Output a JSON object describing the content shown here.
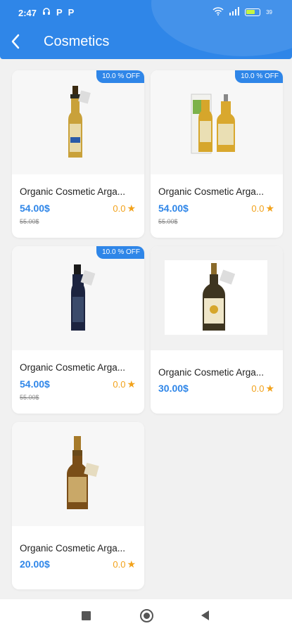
{
  "status_bar": {
    "time": "2:47",
    "left_icons": [
      "headphones-icon",
      "P",
      "P"
    ],
    "right_icons": [
      "wifi-icon",
      "signal-icon",
      "battery-icon"
    ],
    "battery_label": "39"
  },
  "header": {
    "title": "Cosmetics",
    "back_icon": "back-arrow-icon",
    "color": "#2f86e8"
  },
  "products": [
    {
      "name": "Organic Cosmetic Arga...",
      "price": "54.00$",
      "old_price": "55.00$",
      "rating": "0.0",
      "discount": "10.0 % OFF"
    },
    {
      "name": "Organic Cosmetic Arga...",
      "price": "54.00$",
      "old_price": "55.00$",
      "rating": "0.0",
      "discount": "10.0 % OFF"
    },
    {
      "name": "Organic Cosmetic Arga...",
      "price": "54.00$",
      "old_price": "55.00$",
      "rating": "0.0",
      "discount": "10.0 % OFF"
    },
    {
      "name": "Organic Cosmetic Arga...",
      "price": "30.00$",
      "old_price": "",
      "rating": "0.0",
      "discount": ""
    },
    {
      "name": "Organic Cosmetic Arga...",
      "price": "20.00$",
      "old_price": "",
      "rating": "0.0",
      "discount": ""
    }
  ],
  "nav_bar": {
    "icons": [
      "recents-square-icon",
      "home-circle-icon",
      "back-triangle-icon"
    ]
  }
}
